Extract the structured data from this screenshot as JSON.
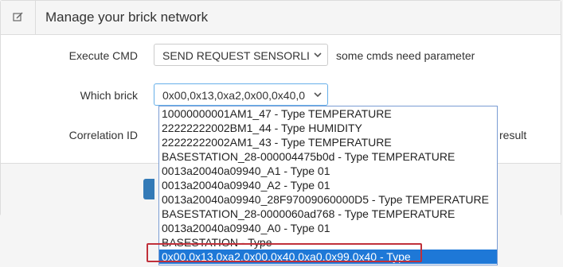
{
  "header": {
    "title": "Manage your brick network",
    "icon": "edit-icon"
  },
  "form": {
    "cmd_label": "Execute CMD",
    "cmd_value": "SEND REQUEST SENSORLI",
    "cmd_hint": "some cmds need parameter",
    "brick_label": "Which brick",
    "brick_value": "0x00,0x13,0xa2,0x00,0x40,0",
    "correlation_label": "Correlation ID",
    "result_hint": "result"
  },
  "dropdown": {
    "options": [
      "10000000001AM1_47 - Type TEMPERATURE",
      "22222222002BM1_44 - Type HUMIDITY",
      "22222222002AM1_43 - Type TEMPERATURE",
      "BASESTATION_28-000004475b0d - Type TEMPERATURE",
      "0013a20040a09940_A1 - Type 01",
      "0013a20040a09940_A2 - Type 01",
      "0013a20040a09940_28F97009060000D5 - Type TEMPERATURE",
      "BASESTATION_28-0000060ad768 - Type TEMPERATURE",
      "0013a20040a09940_A0 - Type 01",
      "BASESTATION - Type",
      "0x00,0x13,0xa2,0x00,0x40,0xa0,0x99,0x40 - Type"
    ],
    "selected_index": 10
  },
  "colors": {
    "selected_bg": "#1e78d7",
    "highlight_border": "#c0303a",
    "primary": "#337ab7"
  }
}
